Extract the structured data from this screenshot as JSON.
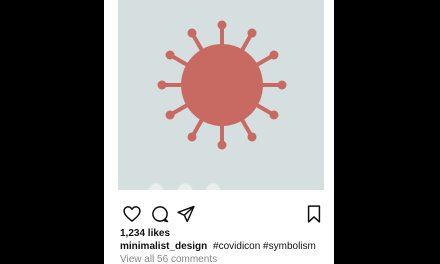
{
  "post": {
    "image_icon": "virus-icon",
    "carousel": {
      "total": 3
    },
    "actions": {
      "like_icon": "heart-icon",
      "comment_icon": "comment-icon",
      "share_icon": "share-icon",
      "save_icon": "bookmark-icon"
    },
    "likes_text": "1,234 likes",
    "username": "minimalist_design",
    "caption_text": "#covidicon #symbolism",
    "view_comments_text": "View all 56 comments",
    "colors": {
      "virus": "#c96a62",
      "background": "#d5dfe0",
      "page": "#000000"
    }
  }
}
